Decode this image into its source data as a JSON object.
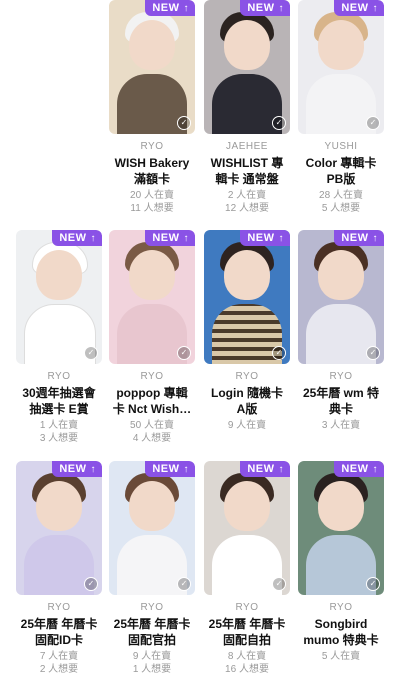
{
  "badge_label": "NEW",
  "accent_color": "#8a52e6",
  "cards": [
    {
      "member": "RYO",
      "title": "WISH Bakery\n滿額卡",
      "have": "20 人在賣",
      "want": "11 人想要",
      "bg": "#e9dcc7",
      "body": "#6a5a4a"
    },
    {
      "member": "JAEHEE",
      "title": "WISHLIST 專\n輯卡 通常盤",
      "have": "2 人在賣",
      "want": "12 人想要",
      "bg": "#b9b4b6",
      "body": "#2a2a33"
    },
    {
      "member": "YUSHI",
      "title": "Color 專輯卡\nPB版",
      "have": "28 人在賣",
      "want": "5 人想要",
      "bg": "#ececf0",
      "body": "#f3f3f5"
    },
    {
      "member": "RYO",
      "title": "30週年抽選會\n抽選卡 E賞",
      "have": "1 人在賣",
      "want": "3 人想要",
      "bg": "#eef0f2",
      "body": "#ffffff"
    },
    {
      "member": "RYO",
      "title": "poppop 專輯\n卡 Nct Wish…",
      "have": "50 人在賣",
      "want": "4 人想要",
      "bg": "#f1d3dc",
      "body": "#e8c6cf"
    },
    {
      "member": "RYO",
      "title": "Login 隨機卡\nA版",
      "have": "9 人在賣",
      "want": "",
      "bg": "#3f7ac0",
      "body": "#d9c8a8"
    },
    {
      "member": "RYO",
      "title": "25年曆 wm 特\n典卡",
      "have": "3 人在賣",
      "want": "",
      "bg": "#b8b8d0",
      "body": "#e7e7ef"
    },
    {
      "member": "RYO",
      "title": "25年曆 年曆卡\n固配ID卡",
      "have": "7 人在賣",
      "want": "2 人想要",
      "bg": "#d7d4ec",
      "body": "#cfc8ea"
    },
    {
      "member": "RYO",
      "title": "25年曆 年曆卡\n固配官拍",
      "have": "9 人在賣",
      "want": "1 人想要",
      "bg": "#dfe7f3",
      "body": "#f5f5f7"
    },
    {
      "member": "RYO",
      "title": "25年曆 年曆卡\n固配自拍",
      "have": "8 人在賣",
      "want": "16 人想要",
      "bg": "#dcd7d2",
      "body": "#ffffff"
    },
    {
      "member": "RYO",
      "title": "Songbird\nmumo 特典卡",
      "have": "5 人在賣",
      "want": "",
      "bg": "#6e8c7a",
      "body": "#b6c7d8"
    }
  ]
}
